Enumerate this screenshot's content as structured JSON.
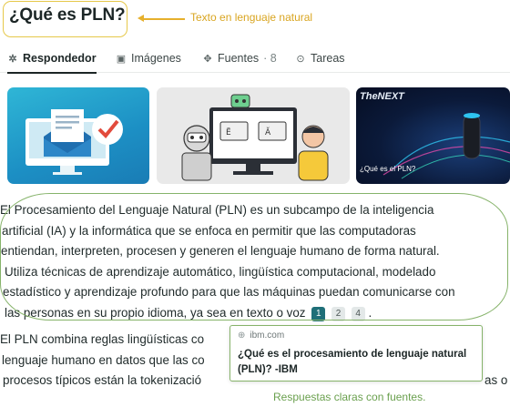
{
  "header": {
    "title": "¿Qué es PLN?",
    "annotation": "Texto en lenguaje natural"
  },
  "tabs": [
    {
      "label": "Respondedor",
      "icon": "responder-icon",
      "count": ""
    },
    {
      "label": "Imágenes",
      "icon": "image-icon",
      "count": ""
    },
    {
      "label": "Fuentes",
      "icon": "sources-icon",
      "count": "· 8"
    },
    {
      "label": "Tareas",
      "icon": "check-circle-icon",
      "count": ""
    }
  ],
  "images": [
    {
      "brand": "",
      "caption": ""
    },
    {
      "brand": "",
      "caption": ""
    },
    {
      "brand": "TheNEXT",
      "caption": "¿Qué es el PLN?"
    }
  ],
  "answer": {
    "lines": [
      "El Procesamiento del Lenguaje Natural (PLN) es un subcampo de la inteligencia",
      "artificial (IA) y la informática que se enfoca en permitir que las computadoras",
      "entiendan, interpreten, procesen y generen el lenguaje humano de forma natural.",
      "Utiliza técnicas de aprendizaje automático, lingüística computacional, modelado",
      "estadístico y aprendizaje profundo para que las máquinas puedan comunicarse con",
      "las personas en su propio idioma, ya sea en texto o voz"
    ],
    "citations": [
      "1",
      "2",
      "4"
    ],
    "end_punct": ".",
    "lines2": [
      "El PLN combina reglas lingüísticas co",
      "lenguaje humano en datos que las co",
      "procesos típicos están la tokenizació"
    ],
    "lines2_tail": [
      "",
      "",
      "as o"
    ]
  },
  "popup": {
    "source": "ibm.com",
    "title": "¿Qué es el procesamiento de lenguaje natural (PLN)? -IBM"
  },
  "annotation_bottom": "Respuestas claras con fuentes.",
  "colors": {
    "accent_yellow": "#e6b02c",
    "accent_green": "#86b36a",
    "citation_active": "#1f6f78"
  }
}
